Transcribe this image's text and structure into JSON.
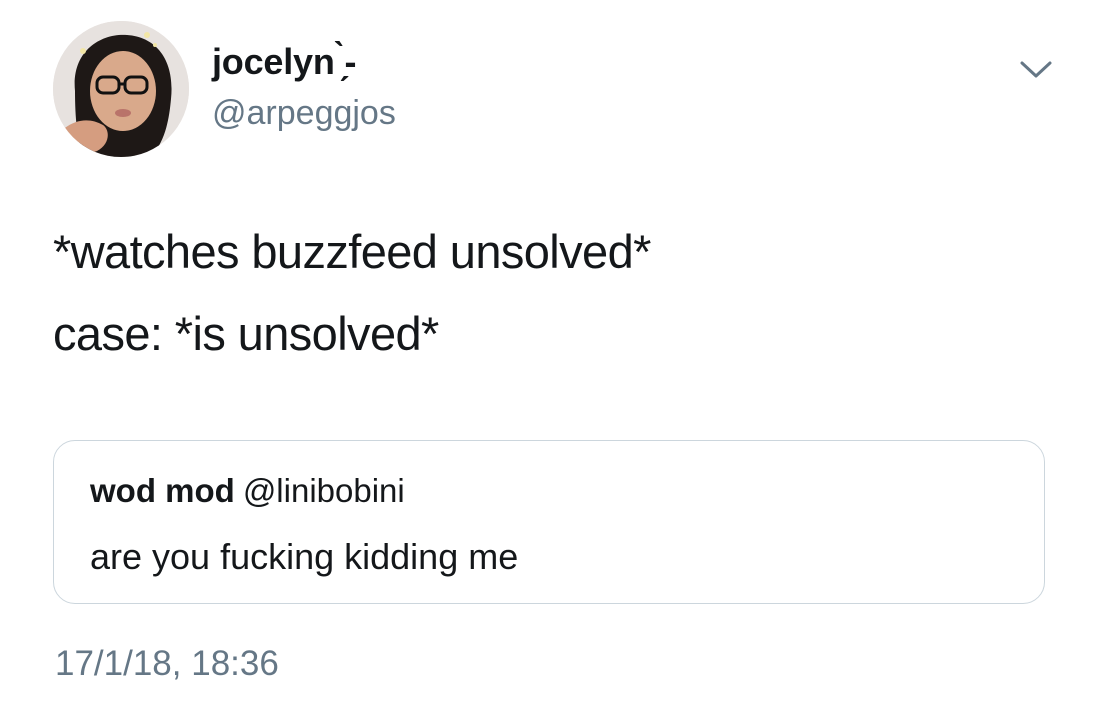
{
  "author": {
    "display_name": "jocelyn ̗̀-",
    "handle": "@arpeggjos",
    "avatar": "profile-photo"
  },
  "menu": {
    "icon": "chevron-down-icon"
  },
  "tweet": {
    "lines": [
      "*watches buzzfeed unsolved*",
      "case: *is unsolved*"
    ]
  },
  "quoted_tweet": {
    "display_name": "wod mod",
    "handle": "@linibobini",
    "text": "are you fucking kidding me"
  },
  "timestamp": "17/1/18, 18:36",
  "colors": {
    "text_primary": "#14171a",
    "text_secondary": "#657786",
    "border": "#ccd6dd"
  }
}
